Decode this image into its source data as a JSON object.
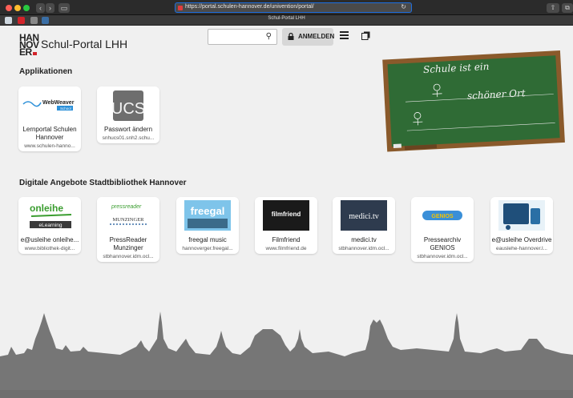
{
  "browser": {
    "url": "https://portal.schulen-hannover.de/univention/portal/",
    "tab_title": "Schul-Portal LHH"
  },
  "header": {
    "logo_lines": [
      "HAN",
      "NOV",
      "ER"
    ],
    "title": "Schul-Portal LHH",
    "search_placeholder": "",
    "login_label": "ANMELDEN"
  },
  "chalkboard": {
    "line1": "Schule ist ein",
    "line2": "schöner Ort"
  },
  "sections": [
    {
      "title": "Applikationen",
      "tiles": [
        {
          "name": "Lernportal Schulen Hannover",
          "url": "www.schulen-hanno..."
        },
        {
          "name": "Passwort ändern",
          "url": "snhucs01.snh2.schu..."
        }
      ]
    },
    {
      "title": "Digitale Angebote Stadtbibliothek Hannover",
      "tiles": [
        {
          "name": "e@usleihe onleihe...",
          "url": "www.bibliothek-digit..."
        },
        {
          "name": "PressReader Munzinger",
          "url": "stbhannover.idm.ocl..."
        },
        {
          "name": "freegal music",
          "url": "hannoverger.freegal..."
        },
        {
          "name": "Filmfriend",
          "url": "www.filmfriend.de"
        },
        {
          "name": "medici.tv",
          "url": "stbhannover.idm.ocl..."
        },
        {
          "name": "Pressearchiv GENIOS",
          "url": "stbhannover.idm.ocl..."
        },
        {
          "name": "e@usleihe Overdrive",
          "url": "eauslehe-hannover.l..."
        }
      ]
    }
  ],
  "logos": {
    "webweaver": "WebWeaver",
    "webweaver_sub": "School",
    "ucs": "UCS",
    "onleihe": "onleihe",
    "elearning": "eLearning",
    "pressreader": "pressreader",
    "munzinger": "MUNZINGER",
    "freegal": "freegal",
    "filmfriend": "filmfriend",
    "medici": "medici.tv",
    "genios": "GENIOS"
  },
  "colors": {
    "accent": "#1e6fe0",
    "chalkboard": "#2f6b35",
    "frame": "#8a5a2b",
    "skyline": "#767676"
  }
}
